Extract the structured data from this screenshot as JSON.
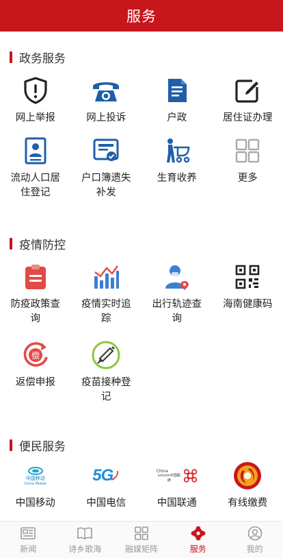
{
  "header": {
    "title": "服务"
  },
  "sections": [
    {
      "title": "政务服务",
      "items": [
        {
          "label": "网上举报",
          "icon": "shield-alert-icon"
        },
        {
          "label": "网上投诉",
          "icon": "telephone-icon"
        },
        {
          "label": "户政",
          "icon": "document-icon"
        },
        {
          "label": "居住证办理",
          "icon": "edit-icon"
        },
        {
          "label": "流动人口居住登记",
          "icon": "id-card-icon"
        },
        {
          "label": "户口簿遗失补发",
          "icon": "certificate-icon"
        },
        {
          "label": "生育收养",
          "icon": "stroller-icon"
        },
        {
          "label": "更多",
          "icon": "more-grid-icon"
        }
      ]
    },
    {
      "title": "疫情防控",
      "items": [
        {
          "label": "防疫政策查询",
          "icon": "clipboard-icon"
        },
        {
          "label": "疫情实时追踪",
          "icon": "bar-chart-icon"
        },
        {
          "label": "出行轨迹查询",
          "icon": "traveler-location-icon"
        },
        {
          "label": "海南健康码",
          "icon": "qr-code-icon"
        },
        {
          "label": "返偿申报",
          "icon": "refund-icon"
        },
        {
          "label": "疫苗接种登记",
          "icon": "syringe-icon"
        }
      ]
    },
    {
      "title": "便民服务",
      "items": [
        {
          "label": "中国移动",
          "icon": "china-mobile-logo",
          "logo_text": [
            "中国移动",
            "China Mobile"
          ]
        },
        {
          "label": "中国电信",
          "icon": "china-telecom-5g-logo",
          "logo_text": [
            "5G"
          ]
        },
        {
          "label": "中国联通",
          "icon": "china-unicom-logo",
          "logo_text": [
            "China",
            "unicom中国联通"
          ]
        },
        {
          "label": "有线缴费",
          "icon": "cable-tv-logo"
        }
      ]
    }
  ],
  "tabbar": [
    {
      "label": "新闻",
      "icon": "news-icon",
      "active": false
    },
    {
      "label": "诗乡歌海",
      "icon": "book-icon",
      "active": false
    },
    {
      "label": "融媒矩阵",
      "icon": "matrix-icon",
      "active": false
    },
    {
      "label": "服务",
      "icon": "service-icon",
      "active": true
    },
    {
      "label": "我的",
      "icon": "user-icon",
      "active": false
    }
  ],
  "colors": {
    "brand": "#c8161d",
    "gov_blue": "#1f5fa8",
    "epidemic_red": "#e24a46"
  }
}
